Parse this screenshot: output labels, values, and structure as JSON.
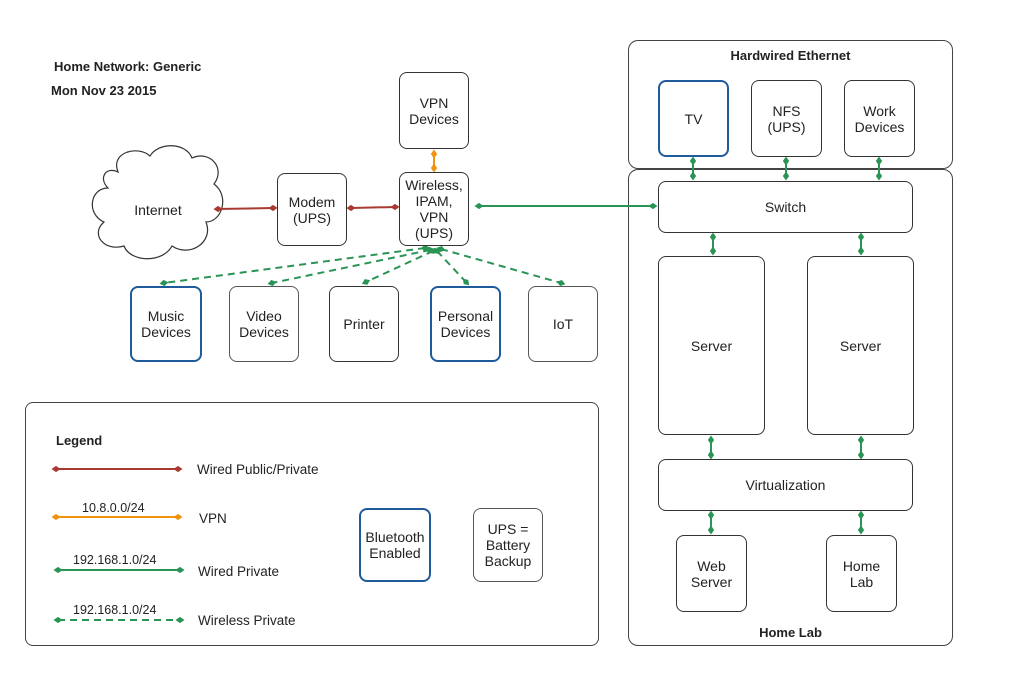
{
  "header": {
    "title": "Home Network: Generic",
    "date": "Mon Nov 23 2015"
  },
  "colors": {
    "wired_public": "#a83a32",
    "vpn": "#f0930f",
    "wired_private": "#2a9455",
    "wireless_private": "#2a9455",
    "bluetooth_border": "#1f5b9a",
    "default_border": "#333333"
  },
  "nodes": {
    "internet": "Internet",
    "modem": "Modem\n(UPS)",
    "wireless": "Wireless,\nIPAM,\nVPN\n(UPS)",
    "vpn_devices": "VPN\nDevices",
    "music": "Music\nDevices",
    "video": "Video\nDevices",
    "printer": "Printer",
    "personal": "Personal\nDevices",
    "iot": "IoT",
    "tv": "TV",
    "nfs": "NFS\n(UPS)",
    "work": "Work\nDevices",
    "switch": "Switch",
    "server1": "Server",
    "server2": "Server",
    "virtualization": "Virtualization",
    "web_server": "Web\nServer",
    "home_lab": "Home\nLab"
  },
  "groups": {
    "hardwired": "Hardwired Ethernet",
    "homelab": "Home Lab"
  },
  "legend": {
    "title": "Legend",
    "items": [
      {
        "label": "Wired Public/Private",
        "sublabel": "",
        "style": "wired_public"
      },
      {
        "label": "VPN",
        "sublabel": "10.8.0.0/24",
        "style": "vpn"
      },
      {
        "label": "Wired Private",
        "sublabel": "192.168.1.0/24",
        "style": "wired_private"
      },
      {
        "label": "Wireless Private",
        "sublabel": "192.168.1.0/24",
        "style": "wireless_private"
      }
    ],
    "bluetooth_key": "Bluetooth\nEnabled",
    "ups_key": "UPS =\nBattery\nBackup"
  }
}
